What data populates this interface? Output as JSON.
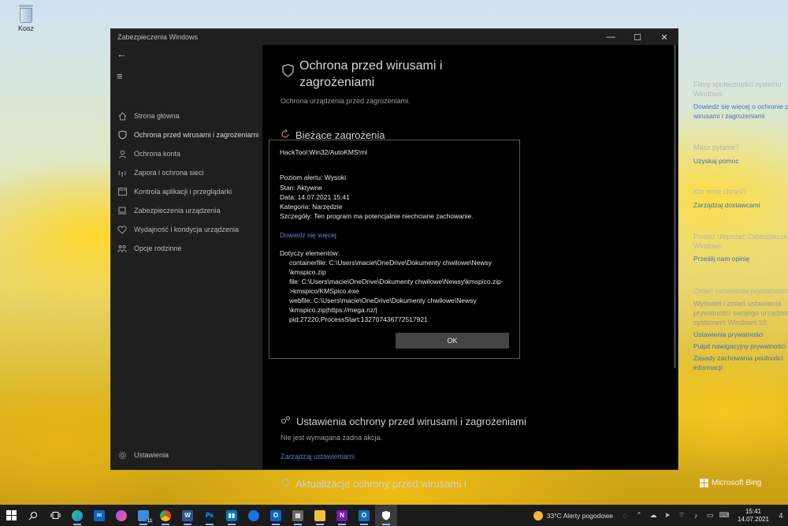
{
  "desktop": {
    "recycle_bin_label": "Kosz"
  },
  "window": {
    "title": "Zabezpieczenia Windows",
    "controls": {
      "minimize": "—",
      "maximize": "☐",
      "close": "✕"
    }
  },
  "sidebar": {
    "back_glyph": "←",
    "menu_glyph": "≡",
    "items": [
      {
        "label": "Strona główna",
        "icon": "home-icon"
      },
      {
        "label": "Ochrona przed wirusami i zagrożeniami",
        "icon": "shield-icon"
      },
      {
        "label": "Ochrona konta",
        "icon": "person-icon"
      },
      {
        "label": "Zapora i ochrona sieci",
        "icon": "wifi-icon"
      },
      {
        "label": "Kontrola aplikacji i przeglądarki",
        "icon": "window-icon"
      },
      {
        "label": "Zabezpieczenia urządzenia",
        "icon": "laptop-icon"
      },
      {
        "label": "Wydajność i kondycja urządzenia",
        "icon": "heart-icon"
      },
      {
        "label": "Opcje rodzinne",
        "icon": "family-icon"
      }
    ],
    "settings_label": "Ustawienia"
  },
  "main": {
    "title": "Ochrona przed wirusami i zagrożeniami",
    "subtitle": "Ochrona urządzenia przed zagrożeniami.",
    "current_threats": "Bieżące zagrożenia",
    "settings_title": "Ustawienia ochrony przed wirusami i zagrożeniami",
    "settings_text": "Nie jest wymagana żadna akcja.",
    "settings_link": "Zarządzaj ustawieniami",
    "updates_title": "Aktualizacje ochrony przed wirusami i"
  },
  "right": {
    "b1_h1": "Filmy społeczności systemu",
    "b1_h2": "Windows",
    "b1_l1": "Dowiedz się więcej o ochronie przed",
    "b1_l2": "wirusami i zagrożeniami",
    "b2_h": "Masz pytanie?",
    "b2_l": "Uzyskaj pomoc",
    "b3_h": "Kto mnie chroni?",
    "b3_l": "Zarządzaj dostawcami",
    "b4_h1": "Pomóż ulepszać Zabezpieczenia",
    "b4_h2": "Windows",
    "b4_l": "Prześlij nam opinię",
    "b5_h": "Zmień ustawienia prywatności",
    "b5_t1": "Wyświetl i zmień ustawienia",
    "b5_t2": "prywatności swojego urządzenia z",
    "b5_t3": "systemem Windows 10.",
    "b5_l1": "Ustawienia prywatności",
    "b5_l2": "Pulpit nawigacyjny prywatności",
    "b5_l3": "Zasady zachowania poufności",
    "b5_l4": "informacji"
  },
  "dialog": {
    "threat_name": "HackTool:Win32/AutoKMS!ml",
    "alert_level": "Poziom alertu:  Wysoki",
    "status": "Stan:  Aktywne",
    "date": "Data:  14.07.2021 15:41",
    "category": "Kategoria:  Narzędzie",
    "details": "Szczegóły:  Ten program ma potencjalnie niechciane zachowanie.",
    "learn_more": "Dowiedz się więcej",
    "affected_label": "Dotyczy elementów:",
    "affected_lines": [
      "containerfile: C:\\Users\\macie\\OneDrive\\Dokumenty chwilowe\\Newsy",
      "\\kmspico.zip",
      "file: C:\\Users\\macie\\OneDrive\\Dokumenty chwilowe\\Newsy\\kmspico.zip-",
      ">kmspico/KMSpico.exe",
      "webfile: C:\\Users\\macie\\OneDrive\\Dokumenty chwilowe\\Newsy",
      "\\kmspico.zip|https://mega.nz/|",
      "pid:27220,ProcessStart:132707436772517921"
    ],
    "ok_label": "OK"
  },
  "bing": {
    "label": "Microsoft Bing"
  },
  "taskbar": {
    "badge_count": "11",
    "weather": "33°C  Alerty pogodowe",
    "time": "15:41",
    "date": "14.07.2021",
    "notif_count": "4"
  }
}
